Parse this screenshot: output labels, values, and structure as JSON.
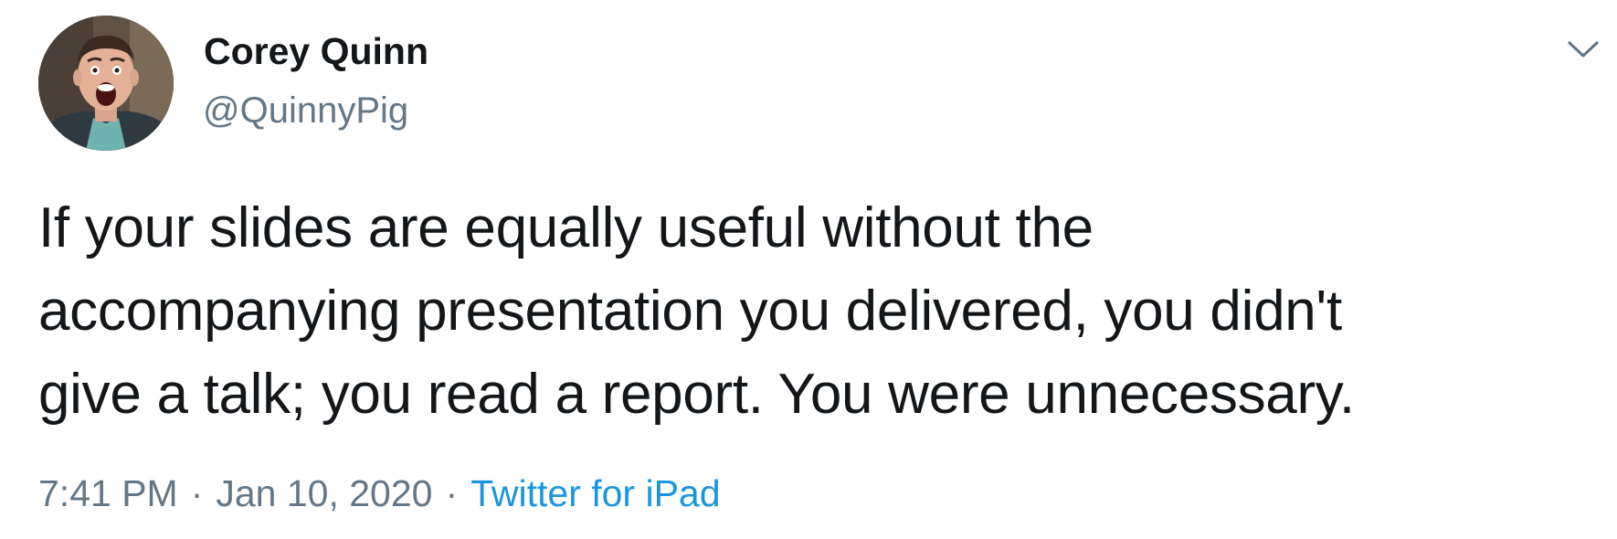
{
  "author": {
    "display_name": "Corey Quinn",
    "handle": "@QuinnyPig"
  },
  "tweet": {
    "text_lines": [
      "If your slides are equally useful without the",
      "accompanying presentation you delivered, you didn't",
      "give a talk; you read a report. You were unnecessary."
    ]
  },
  "meta": {
    "time": "7:41 PM",
    "separator": "·",
    "date": "Jan 10, 2020",
    "source": "Twitter for iPad"
  },
  "icons": {
    "menu": "chevron-down-icon",
    "avatar": "profile-photo"
  },
  "colors": {
    "text": "#14171a",
    "secondary": "#657786",
    "link": "#1b95e0"
  }
}
